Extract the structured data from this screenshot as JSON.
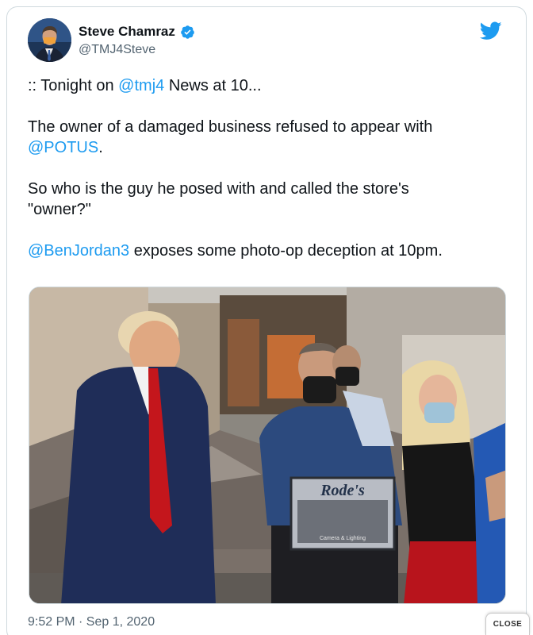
{
  "tweet": {
    "author": {
      "display_name": "Steve Chamraz",
      "handle": "@TMJ4Steve",
      "verified": true,
      "avatar_icon": "avatar-photo"
    },
    "logo_icon": "twitter-bird-icon",
    "lines": {
      "p1_prefix": ":: Tonight on ",
      "p1_mention": "@tmj4",
      "p1_suffix": " News at 10...",
      "p2_text": "The owner of a damaged business refused to appear with",
      "p2_mention": "@POTUS",
      "p2_suffix": ".",
      "p3_text": "So who is the guy he posed with and called the store's \"owner?\"",
      "p4_mention": "@BenJordan3",
      "p4_suffix": " exposes some photo-op deception at 10pm."
    },
    "media": {
      "book_title": "Rode's",
      "book_subtitle": "Camera & Lighting"
    },
    "timestamp": "9:52 PM · Sep 1, 2020"
  },
  "overlay": {
    "close_label": "CLOSE"
  },
  "colors": {
    "link": "#1d9bf0",
    "text": "#0f1419",
    "muted": "#536471",
    "border": "#cfd9de"
  }
}
